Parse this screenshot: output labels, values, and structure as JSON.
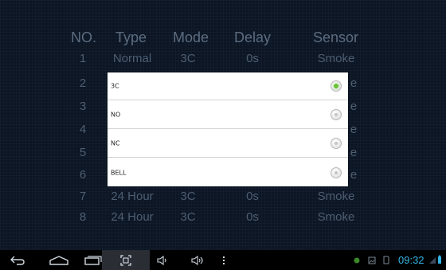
{
  "headers": {
    "no": "NO.",
    "type": "Type",
    "mode": "Mode",
    "delay": "Delay",
    "sensor": "Sensor"
  },
  "rows": [
    {
      "no": "1",
      "type": "Normal",
      "mode": "3C",
      "delay": "0s",
      "sensor": "Smoke"
    },
    {
      "no": "2",
      "type": "",
      "mode": "",
      "delay": "",
      "sensor": "e"
    },
    {
      "no": "3",
      "type": "",
      "mode": "",
      "delay": "",
      "sensor": "e"
    },
    {
      "no": "4",
      "type": "",
      "mode": "",
      "delay": "",
      "sensor": "e"
    },
    {
      "no": "5",
      "type": "",
      "mode": "",
      "delay": "",
      "sensor": "e"
    },
    {
      "no": "6",
      "type": "",
      "mode": "",
      "delay": "",
      "sensor": "e"
    },
    {
      "no": "7",
      "type": "24 Hour",
      "mode": "3C",
      "delay": "0s",
      "sensor": "Smoke"
    },
    {
      "no": "8",
      "type": "24 Hour",
      "mode": "3C",
      "delay": "0s",
      "sensor": "Smoke"
    }
  ],
  "dialog": {
    "options": [
      {
        "label": "3C",
        "selected": true
      },
      {
        "label": "NO",
        "selected": false
      },
      {
        "label": "NC",
        "selected": false
      },
      {
        "label": "BELL",
        "selected": false
      }
    ]
  },
  "navbar": {
    "buttons": [
      "back-icon",
      "home-icon",
      "recent-apps-icon",
      "screenshot-icon",
      "volume-down-icon",
      "volume-up-icon",
      "menu-icon"
    ],
    "status_icons": [
      "notification-dot-icon",
      "image-icon",
      "sd-card-icon",
      "wifi-icon",
      "battery-icon"
    ],
    "time": "09:32"
  },
  "colors": {
    "background": "#0b1524",
    "table_text": "#4e5e72",
    "radio_selected": "#6cc23a",
    "clock": "#33b5e5"
  }
}
